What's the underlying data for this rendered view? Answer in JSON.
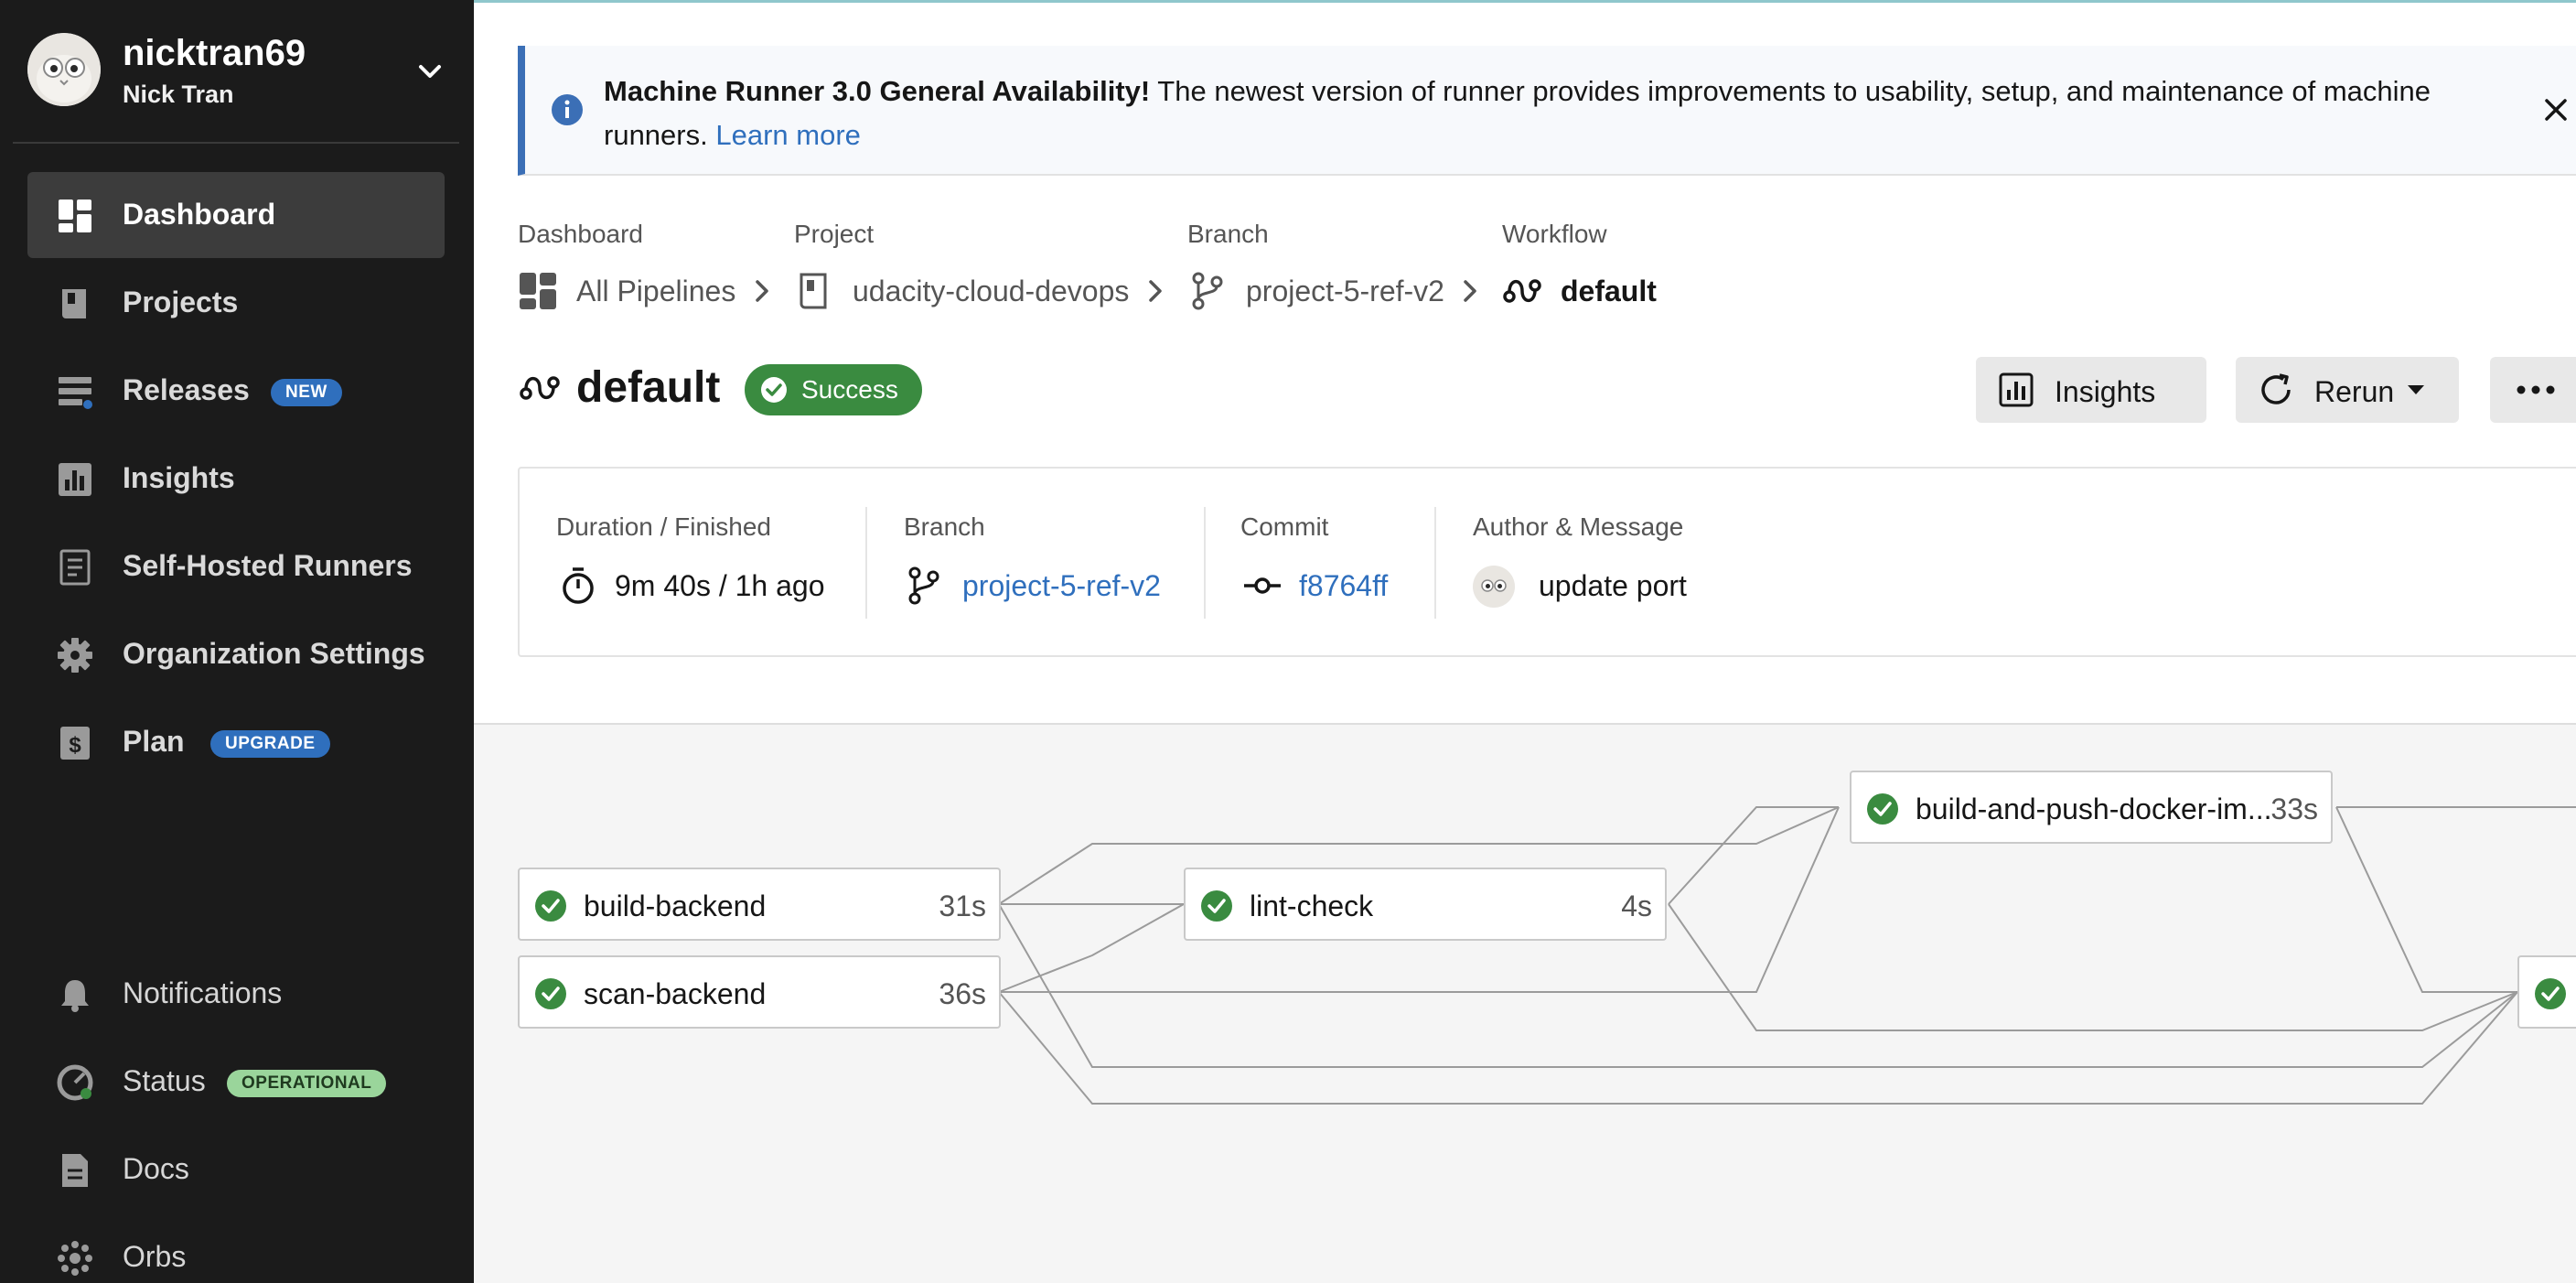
{
  "user": {
    "username": "nicktran69",
    "full_name": "Nick Tran"
  },
  "sidebar": {
    "items": [
      {
        "label": "Dashboard",
        "icon": "dashboard-icon",
        "active": true
      },
      {
        "label": "Projects",
        "icon": "book-icon"
      },
      {
        "label": "Releases",
        "icon": "releases-icon",
        "badge": "NEW"
      },
      {
        "label": "Insights",
        "icon": "bar-chart-icon"
      },
      {
        "label": "Self-Hosted Runners",
        "icon": "runner-icon"
      },
      {
        "label": "Organization Settings",
        "icon": "gear-icon"
      },
      {
        "label": "Plan",
        "icon": "dollar-icon",
        "badge": "UPGRADE"
      }
    ],
    "bottom_items": [
      {
        "label": "Notifications",
        "icon": "bell-icon"
      },
      {
        "label": "Status",
        "icon": "status-icon",
        "badge": "OPERATIONAL"
      },
      {
        "label": "Docs",
        "icon": "doc-icon"
      },
      {
        "label": "Orbs",
        "icon": "orbs-icon"
      }
    ]
  },
  "banner": {
    "title": "Machine Runner 3.0 General Availability!",
    "body": "The newest version of runner provides improvements to usability, setup, and maintenance of machine runners.",
    "link": "Learn more"
  },
  "breadcrumbs": [
    {
      "title": "Dashboard",
      "label": "All Pipelines",
      "icon": "dashboard-icon"
    },
    {
      "title": "Project",
      "label": "udacity-cloud-devops",
      "icon": "book-icon"
    },
    {
      "title": "Branch",
      "label": "project-5-ref-v2",
      "icon": "branch-icon"
    },
    {
      "title": "Workflow",
      "label": "default",
      "icon": "workflow-icon"
    }
  ],
  "workflow": {
    "name": "default",
    "status": "Success",
    "buttons": {
      "insights": "Insights",
      "rerun": "Rerun"
    }
  },
  "info": {
    "duration_label": "Duration / Finished",
    "duration_value": "9m 40s / 1h ago",
    "branch_label": "Branch",
    "branch_value": "project-5-ref-v2",
    "commit_label": "Commit",
    "commit_value": "f8764ff",
    "author_label": "Author & Message",
    "author_message": "update port"
  },
  "jobs": [
    {
      "name": "build-backend",
      "time": "31s",
      "status": "success"
    },
    {
      "name": "scan-backend",
      "time": "36s",
      "status": "success"
    },
    {
      "name": "lint-check",
      "time": "4s",
      "status": "success"
    },
    {
      "name": "build-and-push-docker-im...",
      "time": "33s",
      "status": "success"
    },
    {
      "name": "",
      "time": "",
      "status": "success"
    }
  ],
  "colors": {
    "sidebar_bg": "#1b1b1b",
    "success": "#3a8b40",
    "link": "#2f6fbd",
    "badge_new": "#2f6fbd",
    "badge_operational": "#9ad59b"
  }
}
